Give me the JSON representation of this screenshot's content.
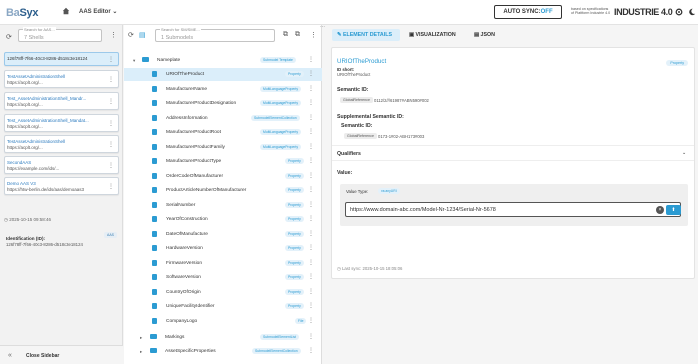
{
  "header": {
    "logo_a": "Ba",
    "logo_b": "Syx",
    "app_name": "AAS Editor",
    "auto_sync_label": "AUTO SYNC:",
    "auto_sync_state": "OFF",
    "based_line1": "based on specifications",
    "based_line2": "of Plattform Industrie 4.0",
    "i40_brand": "INDUSTRIE 4.0"
  },
  "left": {
    "search_label": "Search for AAS...",
    "search_value": "7 Shells",
    "cards": [
      {
        "title": "126f78ff-7f66-40c3-8286-d518c3e18124",
        "sub": ""
      },
      {
        "title": "TestAssetAdministrationShell",
        "sub": "https://acplt.org/..."
      },
      {
        "title": "Test_AssetAdministrationShell_Mandr...",
        "sub": "https://acplt.org/..."
      },
      {
        "title": "Test_AssetAdministrationShell_Mandat...",
        "sub": "https://acplt.org/..."
      },
      {
        "title": "TestAssetAdministrationShell",
        "sub": "https://acplt.org/..."
      },
      {
        "title": "SecondAAS",
        "sub": "https://example.com/ids/..."
      },
      {
        "title": "Demo AAS V3",
        "sub": "https://htw-berlin.de/ids/aas/demoaas3"
      }
    ],
    "timestamp": "2025-10-15 09:58:46",
    "identification_label": "Identification (ID):",
    "identification_value": "126f78ff-7f66-40c3-8286-d518c3e18124",
    "id_badge": "AAS",
    "close_sidebar": "Close Sidebar"
  },
  "middle": {
    "search_label": "Search for SM/SME...",
    "search_value": "1 Submodels",
    "nameplate": {
      "label": "Nameplate",
      "badge": "Submodel Template"
    },
    "items": [
      {
        "label": "URIOfTheProduct",
        "badge": "Property",
        "sel": true
      },
      {
        "label": "ManufacturerName",
        "badge": "MultiLanguageProperty"
      },
      {
        "label": "ManufacturerProductDesignation",
        "badge": "MultiLanguageProperty"
      },
      {
        "label": "AddressInformation",
        "badge": "SubmodelElementCollection"
      },
      {
        "label": "ManufacturerProductRoot",
        "badge": "MultiLanguageProperty"
      },
      {
        "label": "ManufacturerProductFamily",
        "badge": "MultiLanguageProperty"
      },
      {
        "label": "ManufacturerProductType",
        "badge": "Property"
      },
      {
        "label": "OrderCodeOfManufacturer",
        "badge": "Property"
      },
      {
        "label": "ProductArticleNumberOfManufacturer",
        "badge": "Property"
      },
      {
        "label": "SerialNumber",
        "badge": "Property"
      },
      {
        "label": "YearOfConstruction",
        "badge": "Property"
      },
      {
        "label": "DateOfManufacture",
        "badge": "Property"
      },
      {
        "label": "HardwareVersion",
        "badge": "Property"
      },
      {
        "label": "FirmwareVersion",
        "badge": "Property"
      },
      {
        "label": "SoftwareVersion",
        "badge": "Property"
      },
      {
        "label": "CountryOfOrigin",
        "badge": "Property"
      },
      {
        "label": "UniqueFacilityIdentifier",
        "badge": "Property"
      },
      {
        "label": "CompanyLogo",
        "badge": "File"
      }
    ],
    "markings": {
      "label": "Markings",
      "badge": "SubmodelElementList"
    },
    "asset_specific": {
      "label": "AssetSpecificProperties",
      "badge": "SubmodelElementCollection"
    }
  },
  "right": {
    "tabs": [
      "ELEMENT DETAILS",
      "VISUALIZATION",
      "JSON"
    ],
    "title": "URIOfTheProduct",
    "type_badge": "Property",
    "id_short_label": "ID short:",
    "id_short_value": "URIOfTheProduct",
    "semantic_label": "Semantic ID:",
    "semantic_chip": "GlobalReference",
    "semantic_value": "0112/2///61987#ABN590#002",
    "supp_label": "Supplemental Semantic ID:",
    "supp_sub": "Semantic ID:",
    "supp_chip": "GlobalReference",
    "supp_value": "0173-1#02-ABH173#003",
    "qualifiers_label": "Qualifiers",
    "value_label": "Value:",
    "value_type_label": "Value Type:",
    "value_type": "xs:anyURI",
    "value": "https://www.domain-abc.com/Model-Nr-1234/Serial-Nr-5678",
    "last_sync": "Last sync: 2025-10-15 18:05:06"
  },
  "colors": {
    "accent": "#2b9bd2",
    "selected_bg": "#dbeefa"
  }
}
